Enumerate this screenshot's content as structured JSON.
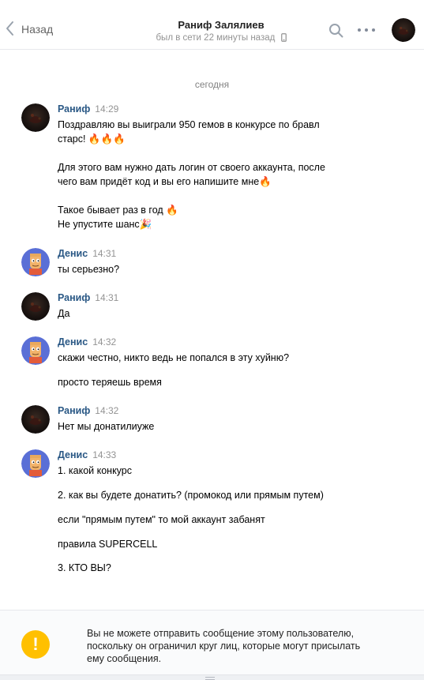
{
  "header": {
    "back_label": "Назад",
    "title": "Раниф Залялиев",
    "status": "был в сети 22 минуты назад"
  },
  "date_separator": "сегодня",
  "messages": [
    {
      "author": "Раниф",
      "time": "14:29",
      "lines": [
        "Поздравляю вы выиграли 950 гемов в конкурсе по бравл",
        "старс! 🔥🔥🔥",
        "Для этого вам нужно дать логин от своего аккаунта, после",
        "чего вам придёт код и вы его напишите мне🔥",
        "Такое бывает раз в год 🔥",
        "Не упустите шанс🎉"
      ]
    },
    {
      "author": "Денис",
      "time": "14:31",
      "lines": [
        "ты серьезно?"
      ]
    },
    {
      "author": "Раниф",
      "time": "14:31",
      "lines": [
        "Да"
      ]
    },
    {
      "author": "Денис",
      "time": "14:32",
      "lines": [
        "скажи честно, никто ведь не попался в эту хуйню?",
        "просто теряешь время"
      ]
    },
    {
      "author": "Раниф",
      "time": "14:32",
      "lines": [
        "Нет мы донатилиуже"
      ]
    },
    {
      "author": "Денис",
      "time": "14:33",
      "lines": [
        "1. какой конкурс",
        "2. как вы будете донатить? (промокод или прямым путем)",
        "если \"прямым путем\" то мой аккаунт забанят",
        "правила SUPERCELL",
        "3. КТО ВЫ?"
      ]
    }
  ],
  "footer": {
    "warning_icon": "!",
    "warning_lines": [
      "Вы не можете отправить сообщение этому пользователю,",
      "поскольку он ограничил круг лиц, которые могут присылать",
      "ему сообщения."
    ]
  },
  "colors": {
    "name_link": "#2a5885",
    "time": "#939393",
    "warning": "#ffc000",
    "header_border": "#e7e8ec"
  },
  "icons": {
    "back": "chevron-left-icon",
    "search": "search-icon",
    "more": "more-dots-icon",
    "phone": "mobile-phone-icon",
    "warning": "exclamation-icon"
  }
}
